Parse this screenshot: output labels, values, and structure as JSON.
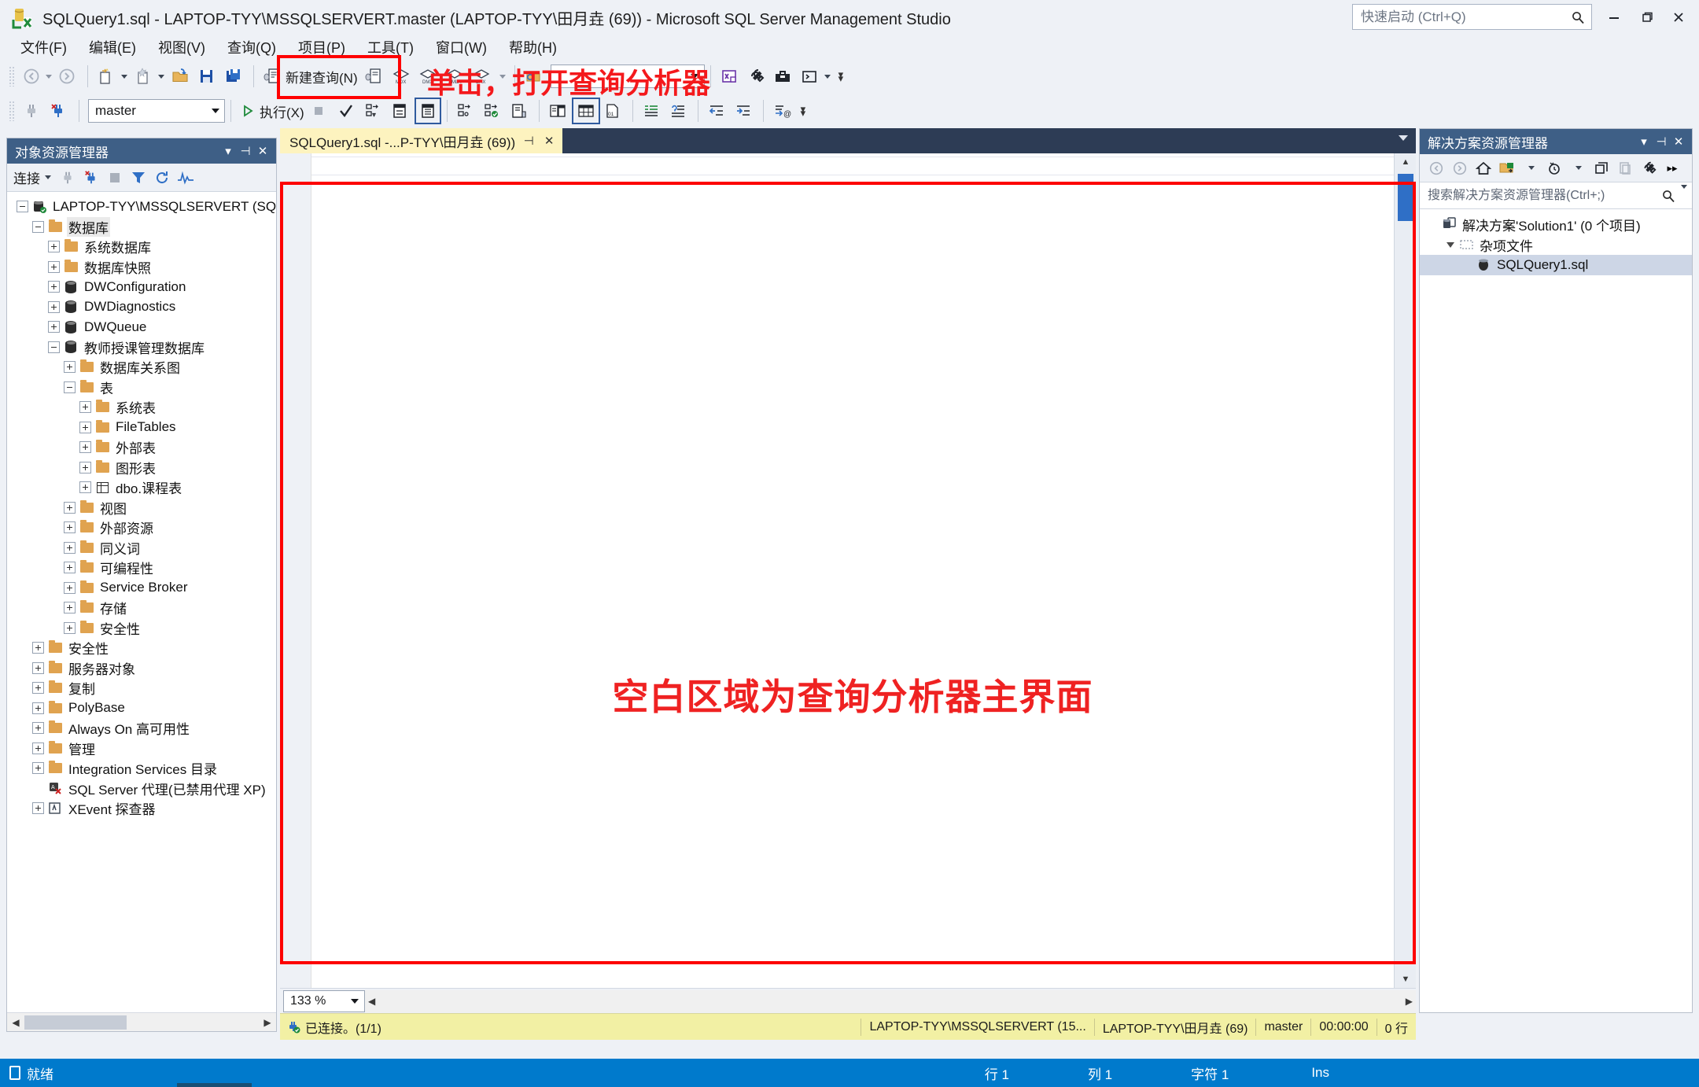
{
  "window": {
    "title": "SQLQuery1.sql - LAPTOP-TYY\\MSSQLSERVERT.master (LAPTOP-TYY\\田月垚 (69)) - Microsoft SQL Server Management Studio",
    "logo_icon": "ssms-logo-icon",
    "minimize_icon": "minimize-icon",
    "maximize_icon": "maximize-icon",
    "close_icon": "close-icon"
  },
  "quick_launch": {
    "placeholder": "快速启动 (Ctrl+Q)",
    "value": "",
    "icon": "search-icon"
  },
  "menu": {
    "items": [
      {
        "label": "文件(F)"
      },
      {
        "label": "编辑(E)"
      },
      {
        "label": "视图(V)"
      },
      {
        "label": "查询(Q)"
      },
      {
        "label": "项目(P)"
      },
      {
        "label": "工具(T)"
      },
      {
        "label": "窗口(W)"
      },
      {
        "label": "帮助(H)"
      }
    ]
  },
  "toolbar1": {
    "nav_back_icon": "nav-back-icon",
    "nav_forward_icon": "nav-forward-icon",
    "new_project_icon": "new-project-icon",
    "new_item_icon": "new-item-icon",
    "open_file_icon": "open-folder-icon",
    "save_icon": "save-icon",
    "save_all_icon": "save-all-icon",
    "new_query_label": "新建查询(N)",
    "new_query_icon": "new-query-icon",
    "new_db_query_icon": "new-db-engine-query-icon",
    "new_mdx_query_icon": "new-mdx-query-icon",
    "new_dmx_query_icon": "new-dmx-query-icon",
    "new_xmla_query_icon": "new-xmla-query-icon",
    "new_dax_query_icon": "new-dax-query-icon",
    "find_icon": "find-in-files-icon",
    "find_value": "",
    "toolbox_icon": "toolbox-icon",
    "properties_icon": "wrench-icon",
    "object_explorer_icon": "object-explorer-icon",
    "terminal_icon": "terminal-icon",
    "overflow_icon": "toolbar-overflow-icon"
  },
  "toolbar2": {
    "connect_icon": "connect-plug-icon",
    "disconnect_icon": "disconnect-plug-icon",
    "database_value": "master",
    "execute_label": "执行(X)",
    "execute_icon": "execute-play-icon",
    "stop_icon": "stop-icon",
    "parse_icon": "parse-check-icon",
    "display_estimated_plan_icon": "estimated-plan-icon",
    "query_options_icon": "query-options-icon",
    "results_to_grid_icon": "results-to-grid-icon",
    "include_actual_plan_icon": "actual-plan-icon",
    "include_live_stats_icon": "live-stats-icon",
    "include_client_stats_icon": "client-stats-icon",
    "results_to_text_icon": "results-to-text-icon",
    "results_to_file_icon": "results-to-file-icon",
    "comment_icon": "comment-selection-icon",
    "uncomment_icon": "uncomment-selection-icon",
    "decrease_indent_icon": "decrease-indent-icon",
    "increase_indent_icon": "increase-indent-icon",
    "specify_values_icon": "specify-template-values-icon",
    "overflow_icon": "toolbar-overflow-icon"
  },
  "annotations": {
    "toolbar_note": "单击，打开查询分析器",
    "editor_note": "空白区域为查询分析器主界面",
    "highlight_color": "#fd0000",
    "text_color": "#ef2222"
  },
  "object_explorer": {
    "title": "对象资源管理器",
    "dropdown_icon": "chevron-down-icon",
    "pin_icon": "pin-icon",
    "close_icon": "close-icon",
    "connect_label": "连接",
    "toolbar_icons": [
      "connect-plug-icon",
      "disconnect-plug-icon",
      "stop-icon",
      "filter-icon",
      "refresh-icon",
      "activity-monitor-icon"
    ],
    "tree": [
      {
        "label": "LAPTOP-TYY\\MSSQLSERVERT (SQL",
        "depth": 0,
        "expander": "minus",
        "icon": "server-icon"
      },
      {
        "label": "数据库",
        "depth": 1,
        "expander": "minus",
        "icon": "folder-icon",
        "highlight": true
      },
      {
        "label": "系统数据库",
        "depth": 2,
        "expander": "plus",
        "icon": "folder-icon"
      },
      {
        "label": "数据库快照",
        "depth": 2,
        "expander": "plus",
        "icon": "folder-icon"
      },
      {
        "label": "DWConfiguration",
        "depth": 2,
        "expander": "plus",
        "icon": "database-icon"
      },
      {
        "label": "DWDiagnostics",
        "depth": 2,
        "expander": "plus",
        "icon": "database-icon"
      },
      {
        "label": "DWQueue",
        "depth": 2,
        "expander": "plus",
        "icon": "database-icon"
      },
      {
        "label": "教师授课管理数据库",
        "depth": 2,
        "expander": "minus",
        "icon": "database-icon"
      },
      {
        "label": "数据库关系图",
        "depth": 3,
        "expander": "plus",
        "icon": "folder-icon"
      },
      {
        "label": "表",
        "depth": 3,
        "expander": "minus",
        "icon": "folder-icon"
      },
      {
        "label": "系统表",
        "depth": 4,
        "expander": "plus",
        "icon": "folder-icon"
      },
      {
        "label": "FileTables",
        "depth": 4,
        "expander": "plus",
        "icon": "folder-icon"
      },
      {
        "label": "外部表",
        "depth": 4,
        "expander": "plus",
        "icon": "folder-icon"
      },
      {
        "label": "图形表",
        "depth": 4,
        "expander": "plus",
        "icon": "folder-icon"
      },
      {
        "label": "dbo.课程表",
        "depth": 4,
        "expander": "plus",
        "icon": "table-icon"
      },
      {
        "label": "视图",
        "depth": 3,
        "expander": "plus",
        "icon": "folder-icon"
      },
      {
        "label": "外部资源",
        "depth": 3,
        "expander": "plus",
        "icon": "folder-icon"
      },
      {
        "label": "同义词",
        "depth": 3,
        "expander": "plus",
        "icon": "folder-icon"
      },
      {
        "label": "可编程性",
        "depth": 3,
        "expander": "plus",
        "icon": "folder-icon"
      },
      {
        "label": "Service Broker",
        "depth": 3,
        "expander": "plus",
        "icon": "folder-icon"
      },
      {
        "label": "存储",
        "depth": 3,
        "expander": "plus",
        "icon": "folder-icon"
      },
      {
        "label": "安全性",
        "depth": 3,
        "expander": "plus",
        "icon": "folder-icon"
      },
      {
        "label": "安全性",
        "depth": 1,
        "expander": "plus",
        "icon": "folder-icon"
      },
      {
        "label": "服务器对象",
        "depth": 1,
        "expander": "plus",
        "icon": "folder-icon"
      },
      {
        "label": "复制",
        "depth": 1,
        "expander": "plus",
        "icon": "folder-icon"
      },
      {
        "label": "PolyBase",
        "depth": 1,
        "expander": "plus",
        "icon": "folder-icon"
      },
      {
        "label": "Always On 高可用性",
        "depth": 1,
        "expander": "plus",
        "icon": "folder-icon"
      },
      {
        "label": "管理",
        "depth": 1,
        "expander": "plus",
        "icon": "folder-icon"
      },
      {
        "label": "Integration Services 目录",
        "depth": 1,
        "expander": "plus",
        "icon": "folder-icon"
      },
      {
        "label": "SQL Server 代理(已禁用代理 XP)",
        "depth": 1,
        "expander": "none",
        "icon": "sql-agent-disabled-icon"
      },
      {
        "label": "XEvent 探查器",
        "depth": 1,
        "expander": "plus",
        "icon": "xevent-profiler-icon"
      }
    ]
  },
  "editor": {
    "tab": {
      "label": "SQLQuery1.sql -...P-TYY\\田月垚 (69))",
      "pin_icon": "pin-icon",
      "close_icon": "close-icon"
    },
    "tabstrip_menu_icon": "chevron-down-icon",
    "content": "",
    "zoom": "133 %",
    "zoom_dropdown_icon": "chevron-down-icon",
    "scroll_up_icon": "scroll-up-icon",
    "scroll_down_icon": "scroll-down-icon",
    "scroll_left_icon": "scroll-left-icon",
    "scroll_right_icon": "scroll-right-icon"
  },
  "query_status": {
    "connected_icon": "connected-icon",
    "connected_label": "已连接。(1/1)",
    "server": "LAPTOP-TYY\\MSSQLSERVERT (15...",
    "user": "LAPTOP-TYY\\田月垚 (69)",
    "database": "master",
    "elapsed": "00:00:00",
    "rows": "0 行"
  },
  "solution_explorer": {
    "title": "解决方案资源管理器",
    "dropdown_icon": "chevron-down-icon",
    "pin_icon": "pin-icon",
    "close_icon": "close-icon",
    "toolbar_icons": [
      "nav-back-icon",
      "nav-forward-icon",
      "home-icon",
      "show-all-files-icon",
      "pending-changes-filter-icon",
      "collapse-all-icon",
      "preview-selected-items-icon",
      "properties-wrench-icon",
      "overflow-icon"
    ],
    "search_placeholder": "搜索解决方案资源管理器(Ctrl+;)",
    "search_value": "",
    "search_icon": "search-icon",
    "search_dropdown_icon": "chevron-down-icon",
    "tree": [
      {
        "label": "解决方案'Solution1' (0 个项目)",
        "depth": 0,
        "expander": "none",
        "icon": "solution-icon",
        "selected": false
      },
      {
        "label": "杂项文件",
        "depth": 1,
        "expander": "tri-down",
        "icon": "misc-files-icon",
        "selected": false
      },
      {
        "label": "SQLQuery1.sql",
        "depth": 2,
        "expander": "none",
        "icon": "sql-file-icon",
        "selected": true
      }
    ]
  },
  "statusbar": {
    "ready_icon": "ready-icon",
    "ready_label": "就绪",
    "line_label": "行 1",
    "column_label": "列 1",
    "char_label": "字符 1",
    "insert_label": "Ins"
  }
}
